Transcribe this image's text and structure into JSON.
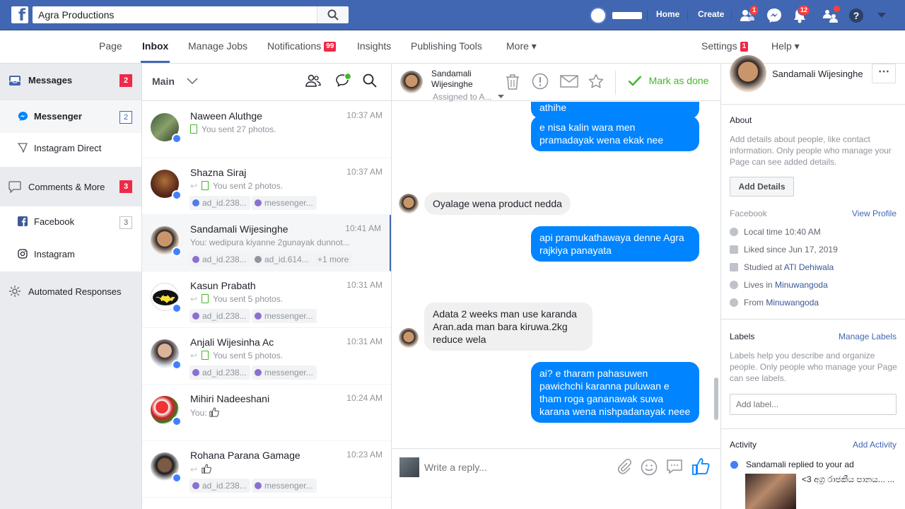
{
  "topbar": {
    "search_value": "Agra Productions",
    "links": [
      "Home",
      "Create"
    ],
    "friend_requests_badge": "1",
    "notifications_badge": "12"
  },
  "page_nav": {
    "items": [
      "Page",
      "Inbox",
      "Manage Jobs",
      "Notifications",
      "Insights",
      "Publishing Tools",
      "More ▾"
    ],
    "notifications_badge": "99",
    "settings_label": "Settings",
    "settings_badge": "1",
    "help_label": "Help ▾"
  },
  "sidebar": {
    "messages": {
      "label": "Messages",
      "count": "2"
    },
    "messenger": {
      "label": "Messenger",
      "count": "2"
    },
    "instagram_direct": {
      "label": "Instagram Direct"
    },
    "comments": {
      "label": "Comments & More",
      "count": "3"
    },
    "facebook": {
      "label": "Facebook",
      "count": "3"
    },
    "instagram": {
      "label": "Instagram"
    },
    "automated": {
      "label": "Automated Responses"
    }
  },
  "conv_list": {
    "filter_label": "Main",
    "conversations": [
      {
        "name": "Naween Aluthge",
        "time": "10:37 AM",
        "snippet": "You sent 27 photos.",
        "tags": []
      },
      {
        "name": "Shazna Siraj",
        "time": "10:37 AM",
        "snippet": "You sent 2 photos.",
        "tags": [
          "ad_id.238...",
          "messenger..."
        ]
      },
      {
        "name": "Sandamali Wijesinghe",
        "time": "10:41 AM",
        "snippet": "You: wedipura kiyanne 2gunayak dunnot...",
        "tags": [
          "ad_id.238...",
          "ad_id.614...",
          "+1 more"
        ]
      },
      {
        "name": "Kasun Prabath",
        "time": "10:31 AM",
        "snippet": "You sent 5 photos.",
        "tags": [
          "ad_id.238...",
          "messenger..."
        ]
      },
      {
        "name": "Anjali Wijesinha Ac",
        "time": "10:31 AM",
        "snippet": "You sent 5 photos.",
        "tags": [
          "ad_id.238...",
          "messenger..."
        ]
      },
      {
        "name": "Mihiri Nadeeshani",
        "time": "10:24 AM",
        "snippet": "You:",
        "tags": []
      },
      {
        "name": "Rohana Parana Gamage",
        "time": "10:23 AM",
        "snippet": "",
        "tags": [
          "ad_id.238...",
          "messenger..."
        ]
      }
    ]
  },
  "chat": {
    "contact_name": "Sandamali Wijesinghe",
    "assigned": "Assigned to A...",
    "mark_done": "Mark as done",
    "messages": [
      {
        "dir": "out",
        "text": "athihe"
      },
      {
        "dir": "out",
        "text": "e nisa kalin wara men pramadayak wena ekak nee"
      },
      {
        "dir": "in",
        "text": "Oyalage wena product nedda"
      },
      {
        "dir": "out",
        "text": "api pramukathawaya denne Agra rajkiya panayata"
      },
      {
        "dir": "in",
        "text": "Adata 2 weeks man use karanda Aran.ada man bara kiruwa.2kg reduce wela"
      },
      {
        "dir": "out",
        "text": "ai? e tharam pahasuwen pawichchi karanna puluwan e tham roga gananawak suwa karana wena nishpadanayak neee"
      }
    ],
    "composer_placeholder": "Write a reply..."
  },
  "right_panel": {
    "name": "Sandamali Wijesinghe",
    "about_title": "About",
    "about_text": "Add details about people, like contact information. Only people who manage your Page can see added details.",
    "add_details": "Add Details",
    "facebook_title": "Facebook",
    "view_profile": "View Profile",
    "local_time": "Local time 10:40 AM",
    "liked_since": "Liked since Jun 17, 2019",
    "studied_prefix": "Studied at ",
    "studied_at": "ATI Dehiwala",
    "lives_prefix": "Lives in ",
    "lives_in": "Minuwangoda",
    "from_prefix": "From ",
    "from": "Minuwangoda",
    "labels_title": "Labels",
    "manage_labels": "Manage Labels",
    "labels_text": "Labels help you describe and organize people. Only people who manage your Page can see labels.",
    "label_placeholder": "Add label...",
    "activity_title": "Activity",
    "add_activity": "Add Activity",
    "activity_item": "Sandamali replied to your ad",
    "ad_title": "<3 අග්‍ර රාජකීය පානය... ..."
  },
  "colors": {
    "brand": "#4267b2",
    "messenger_blue": "#0084ff",
    "badge_red": "#f02849",
    "done_green": "#42b72a"
  }
}
